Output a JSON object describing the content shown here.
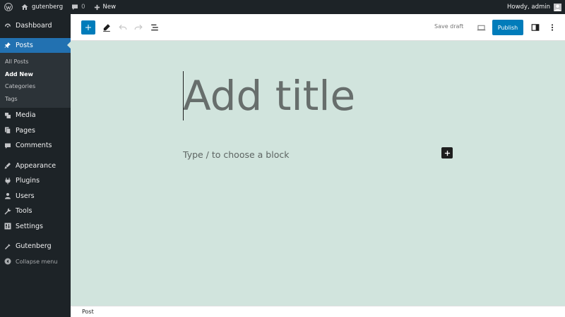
{
  "admin_bar": {
    "site_name": "gutenberg",
    "comments_count": "0",
    "new_label": "New",
    "greeting": "Howdy, admin"
  },
  "sidebar": {
    "items": [
      {
        "label": "Dashboard",
        "icon": "dashboard-icon"
      },
      {
        "label": "Posts",
        "icon": "pin-icon",
        "current": true
      },
      {
        "label": "Media",
        "icon": "media-icon"
      },
      {
        "label": "Pages",
        "icon": "pages-icon"
      },
      {
        "label": "Comments",
        "icon": "comments-icon"
      },
      {
        "label": "Appearance",
        "icon": "appearance-icon"
      },
      {
        "label": "Plugins",
        "icon": "plugins-icon"
      },
      {
        "label": "Users",
        "icon": "users-icon"
      },
      {
        "label": "Tools",
        "icon": "tools-icon"
      },
      {
        "label": "Settings",
        "icon": "settings-icon"
      },
      {
        "label": "Gutenberg",
        "icon": "gutenberg-icon"
      }
    ],
    "submenu": [
      "All Posts",
      "Add New",
      "Categories",
      "Tags"
    ],
    "active_submenu": "Add New",
    "collapse_label": "Collapse menu"
  },
  "header": {
    "save_draft": "Save draft",
    "publish": "Publish"
  },
  "canvas": {
    "title_placeholder": "Add title",
    "block_placeholder": "Type / to choose a block"
  },
  "footer": {
    "breadcrumb": "Post"
  },
  "colors": {
    "admin_dark": "#1d2327",
    "accent": "#2271b1",
    "publish_blue": "#007cba",
    "canvas_bg": "#d1e4dd"
  }
}
